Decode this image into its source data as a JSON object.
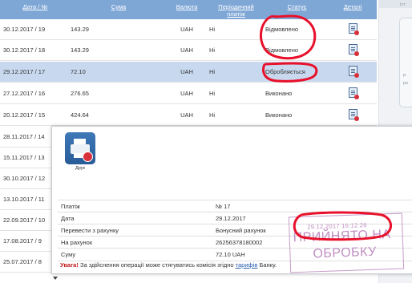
{
  "table": {
    "headers": [
      "Дата / №",
      "Сума",
      "Валюта",
      "Періодичний платіж",
      "Статус",
      "Деталі"
    ],
    "rows": [
      {
        "date": "30.12.2017 / 19",
        "sum": "143.29",
        "currency": "UAH",
        "periodic": "Ні",
        "status": "Відмовлено"
      },
      {
        "date": "30.12.2017 / 18",
        "sum": "143.29",
        "currency": "UAH",
        "periodic": "Ні",
        "status": "Відмовлено"
      },
      {
        "date": "29.12.2017 / 17",
        "sum": "72.10",
        "currency": "UAH",
        "periodic": "Ні",
        "status": "Обробляється"
      },
      {
        "date": "27.12.2017 / 16",
        "sum": "276.65",
        "currency": "UAH",
        "periodic": "Ні",
        "status": "Виконано"
      },
      {
        "date": "20.12.2017 / 15",
        "sum": "424.64",
        "currency": "UAH",
        "periodic": "Ні",
        "status": "Виконано"
      },
      {
        "date": "28.11.2017 / 14"
      },
      {
        "date": "15.11.2017 / 13"
      },
      {
        "date": "30.10.2017 / 12"
      },
      {
        "date": "13.10.2017 / 11"
      },
      {
        "date": "22.09.2017 / 10"
      },
      {
        "date": "17.08.2017 / 9"
      },
      {
        "date": "25.07.2017 / 8"
      }
    ]
  },
  "right_panel": {
    "line1": "Іст",
    "line2": "Р",
    "line3": "ро"
  },
  "modal": {
    "print_label": "Друк",
    "details": [
      {
        "key": "Платіж",
        "value": "№ 17"
      },
      {
        "key": "Дата",
        "value": "29.12.2017"
      },
      {
        "key": "Перевести з рахунку",
        "value": "Бонусний рахунок"
      },
      {
        "key": "На рахунок",
        "value": "26256378180002"
      },
      {
        "key": "Суму",
        "value": "72.10 UAH"
      }
    ],
    "note_warning": "Увага!",
    "note_text": " За здійснення операції може стягуватись комісія згідно ",
    "note_link": "тарифів",
    "note_end": " Банку."
  },
  "stamp": {
    "date": "29.12.2017 16:12:26",
    "line1": "ПРИЙНЯТО НА",
    "line2": "ОБРОБКУ"
  },
  "colors": {
    "header": "#7fa7d6",
    "selected_row": "#c8d9ef",
    "annotation": "#e8102a",
    "stamp": "#c18ec1"
  }
}
